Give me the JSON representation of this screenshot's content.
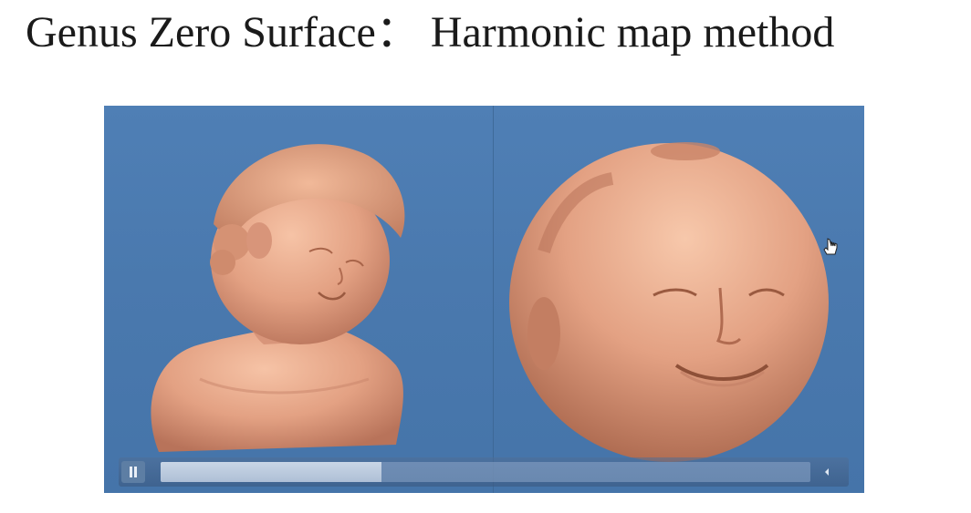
{
  "slide": {
    "title": "Genus Zero Surface： Harmonic map method"
  },
  "player": {
    "play_state": "playing",
    "progress_fraction": 0.34,
    "pause_icon": "pause-icon",
    "volume_icon": "volume-icon"
  },
  "colors": {
    "background": "#4a79ae",
    "surface": "#e3a383"
  }
}
